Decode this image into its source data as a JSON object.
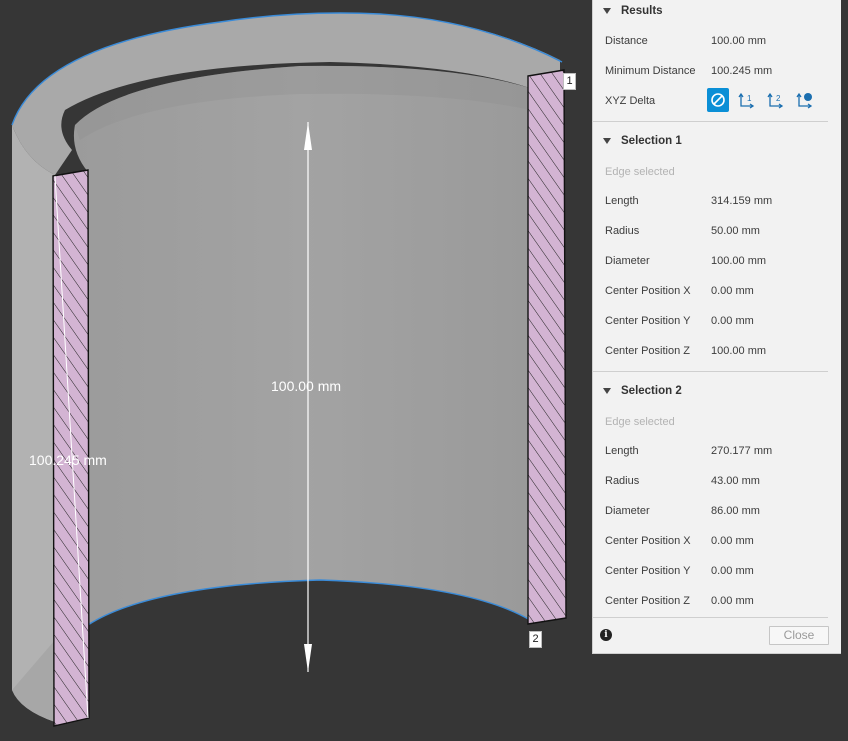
{
  "viewport": {
    "height_label": "100.00 mm",
    "min_label": "100.245 mm",
    "marker_1": "1",
    "marker_2": "2"
  },
  "panel": {
    "results": {
      "title": "Results",
      "distance_label": "Distance",
      "distance_value": "100.00 mm",
      "min_distance_label": "Minimum Distance",
      "min_distance_value": "100.245 mm",
      "xyz_label": "XYZ Delta",
      "xyz_buttons": [
        "none-icon",
        "delta-1-icon",
        "delta-2-icon",
        "delta-both-icon"
      ]
    },
    "selection1": {
      "title": "Selection 1",
      "status": "Edge selected",
      "rows": [
        {
          "label": "Length",
          "value": "314.159 mm"
        },
        {
          "label": "Radius",
          "value": "50.00 mm"
        },
        {
          "label": "Diameter",
          "value": "100.00 mm"
        },
        {
          "label": "Center Position X",
          "value": "0.00 mm"
        },
        {
          "label": "Center Position Y",
          "value": "0.00 mm"
        },
        {
          "label": "Center Position Z",
          "value": "100.00 mm"
        }
      ]
    },
    "selection2": {
      "title": "Selection 2",
      "status": "Edge selected",
      "rows": [
        {
          "label": "Length",
          "value": "270.177 mm"
        },
        {
          "label": "Radius",
          "value": "43.00 mm"
        },
        {
          "label": "Diameter",
          "value": "86.00 mm"
        },
        {
          "label": "Center Position X",
          "value": "0.00 mm"
        },
        {
          "label": "Center Position Y",
          "value": "0.00 mm"
        },
        {
          "label": "Center Position Z",
          "value": "0.00 mm"
        }
      ]
    },
    "close_label": "Close",
    "info_glyph": "i"
  },
  "colors": {
    "background": "#363636",
    "accent": "#0b8fd6",
    "section_fill": "#d3b4d3"
  }
}
